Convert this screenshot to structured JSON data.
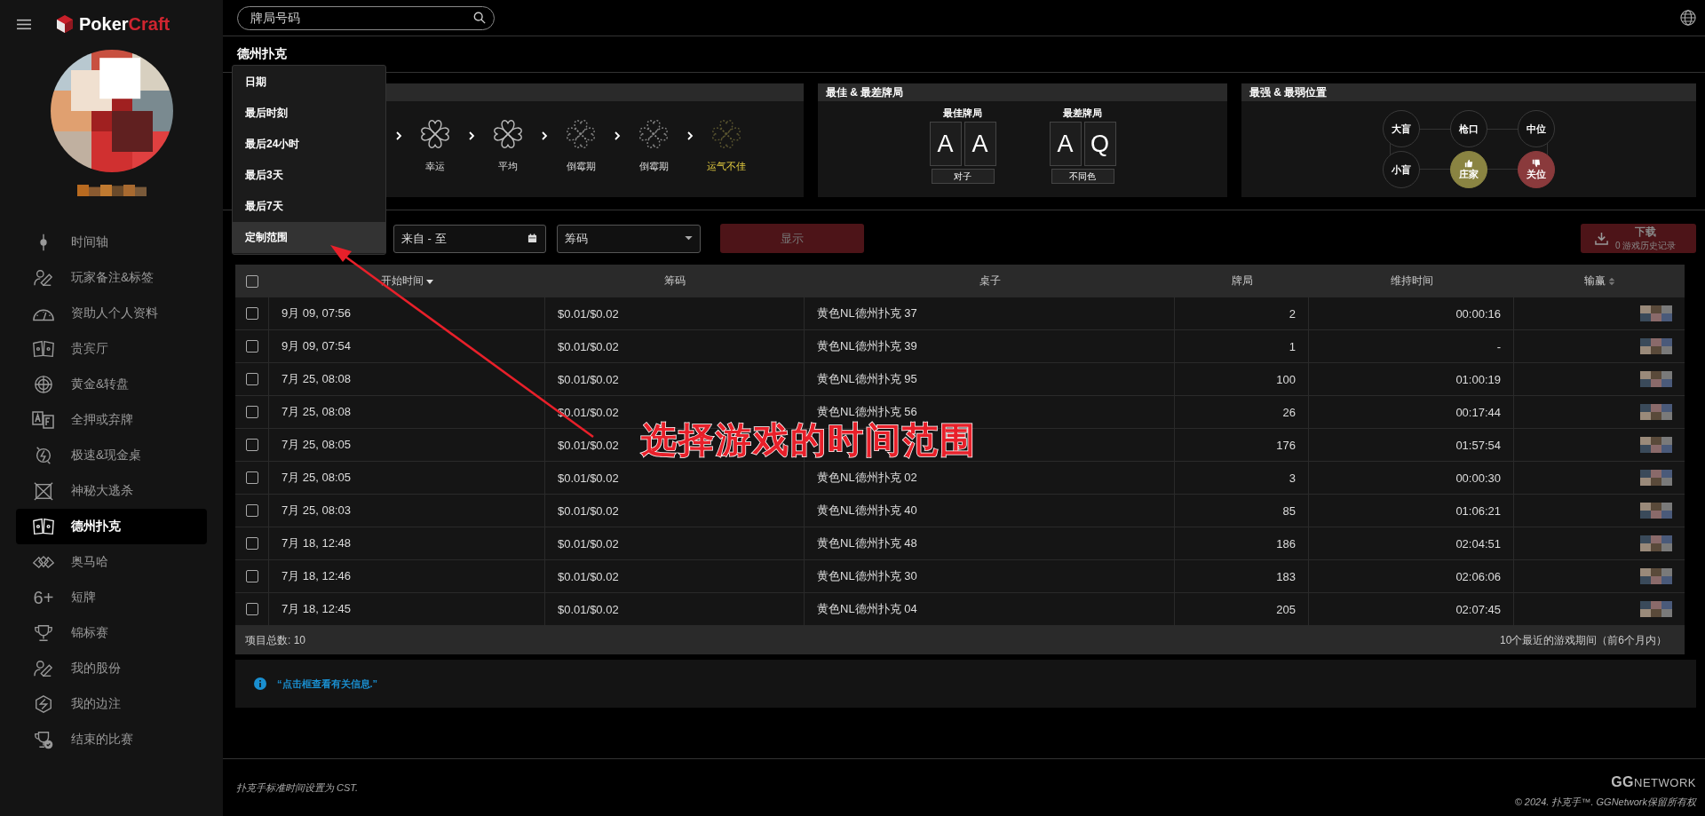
{
  "logo": {
    "part1": "Poker",
    "part2": "Craft"
  },
  "search": {
    "placeholder": "牌局号码"
  },
  "sidebar": {
    "items": [
      {
        "label": "时间轴",
        "selected": false
      },
      {
        "label": "玩家备注&标签",
        "selected": false
      },
      {
        "label": "资助人个人资料",
        "selected": false
      },
      {
        "label": "贵宾厅",
        "selected": false
      },
      {
        "label": "黄金&转盘",
        "selected": false
      },
      {
        "label": "全押或弃牌",
        "selected": false
      },
      {
        "label": "极速&现金桌",
        "selected": false
      },
      {
        "label": "神秘大逃杀",
        "selected": false
      },
      {
        "label": "德州扑克",
        "selected": true
      },
      {
        "label": "奥马哈",
        "selected": false
      },
      {
        "label": "短牌",
        "icon_text": "6+",
        "selected": false
      },
      {
        "label": "锦标赛",
        "selected": false
      },
      {
        "label": "我的股份",
        "selected": false
      },
      {
        "label": "我的边注",
        "selected": false
      },
      {
        "label": "结束的比赛",
        "selected": false
      }
    ]
  },
  "page_title": "德州扑克",
  "luck": {
    "steps": [
      {
        "label": "幸运",
        "kind": "solid"
      },
      {
        "label": "平均",
        "kind": "solid"
      },
      {
        "label": "倒霉期",
        "kind": "dashed"
      },
      {
        "label": "倒霉期",
        "kind": "half"
      },
      {
        "label": "运气不佳",
        "kind": "faint"
      }
    ]
  },
  "best_worst": {
    "title": "最佳 & 最差牌局",
    "hands": [
      {
        "label": "最佳牌局",
        "cards": [
          "A",
          "A"
        ],
        "caption": "对子"
      },
      {
        "label": "最差牌局",
        "cards": [
          "A",
          "Q"
        ],
        "caption": "不同色"
      }
    ]
  },
  "positions": {
    "title": "最强 & 最弱位置",
    "seats": [
      {
        "label": "大盲",
        "kind": "plain"
      },
      {
        "label": "枪口",
        "kind": "plain"
      },
      {
        "label": "中位",
        "kind": "plain"
      },
      {
        "label": "小盲",
        "kind": "plain"
      },
      {
        "label": "庄家",
        "kind": "strong"
      },
      {
        "label": "关位",
        "kind": "weak"
      }
    ]
  },
  "date_menu": {
    "items": [
      {
        "label": "日期",
        "selected": false
      },
      {
        "label": "最后时刻",
        "selected": false
      },
      {
        "label": "最后24小时",
        "selected": false
      },
      {
        "label": "最后3天",
        "selected": false
      },
      {
        "label": "最后7天",
        "selected": false
      },
      {
        "label": "定制范围",
        "selected": true
      }
    ]
  },
  "filters": {
    "range": {
      "placeholder": "来自 - 至"
    },
    "stakes": {
      "value": "筹码"
    },
    "show_button": "显示",
    "download": {
      "label": "下载",
      "sublabel": "0 游戏历史记录"
    }
  },
  "table": {
    "select_all_checked": false,
    "columns": [
      {
        "label": "开始时间",
        "kind": "sorted-desc"
      },
      {
        "label": "筹码",
        "kind": "plain"
      },
      {
        "label": "桌子",
        "kind": "plain"
      },
      {
        "label": "牌局",
        "kind": "plain"
      },
      {
        "label": "维持时间",
        "kind": "plain"
      },
      {
        "label": "输赢",
        "kind": "sortable"
      }
    ],
    "rows": [
      {
        "checked": false,
        "start": "9月 09, 07:56",
        "stakes": "$0.01/$0.02",
        "table": "黄色NL德州扑克 37",
        "hands": "2",
        "duration": "00:00:16"
      },
      {
        "checked": false,
        "start": "9月 09, 07:54",
        "stakes": "$0.01/$0.02",
        "table": "黄色NL德州扑克 39",
        "hands": "1",
        "duration": "-"
      },
      {
        "checked": false,
        "start": "7月 25, 08:08",
        "stakes": "$0.01/$0.02",
        "table": "黄色NL德州扑克 95",
        "hands": "100",
        "duration": "01:00:19"
      },
      {
        "checked": false,
        "start": "7月 25, 08:08",
        "stakes": "$0.01/$0.02",
        "table": "黄色NL德州扑克 56",
        "hands": "26",
        "duration": "00:17:44"
      },
      {
        "checked": false,
        "start": "7月 25, 08:05",
        "stakes": "$0.01/$0.02",
        "hands": "176",
        "duration": "01:57:54"
      },
      {
        "checked": false,
        "start": "7月 25, 08:05",
        "stakes": "$0.01/$0.02",
        "table": "黄色NL德州扑克 02",
        "hands": "3",
        "duration": "00:00:30"
      },
      {
        "checked": false,
        "start": "7月 25, 08:03",
        "stakes": "$0.01/$0.02",
        "table": "黄色NL德州扑克 40",
        "hands": "85",
        "duration": "01:06:21"
      },
      {
        "checked": false,
        "start": "7月 18, 12:48",
        "stakes": "$0.01/$0.02",
        "table": "黄色NL德州扑克 48",
        "hands": "186",
        "duration": "02:04:51"
      },
      {
        "checked": false,
        "start": "7月 18, 12:46",
        "stakes": "$0.01/$0.02",
        "table": "黄色NL德州扑克 30",
        "hands": "183",
        "duration": "02:06:06"
      },
      {
        "checked": false,
        "start": "7月 18, 12:45",
        "stakes": "$0.01/$0.02",
        "table": "黄色NL德州扑克 04",
        "hands": "205",
        "duration": "02:07:45"
      }
    ],
    "total": "项目总数: 10",
    "note": "10个最近的游戏期间（前6个月内）"
  },
  "info": "“点击框查看有关信息.”",
  "footer": {
    "timezone": "扑克手标准时间设置为 CST.",
    "brand1": "GG",
    "brand2": "NETWORK",
    "copyright": "© 2024. 扑克手™. GGNetwork保留所有权"
  },
  "annotation": {
    "text": "选择游戏的时间范围"
  }
}
